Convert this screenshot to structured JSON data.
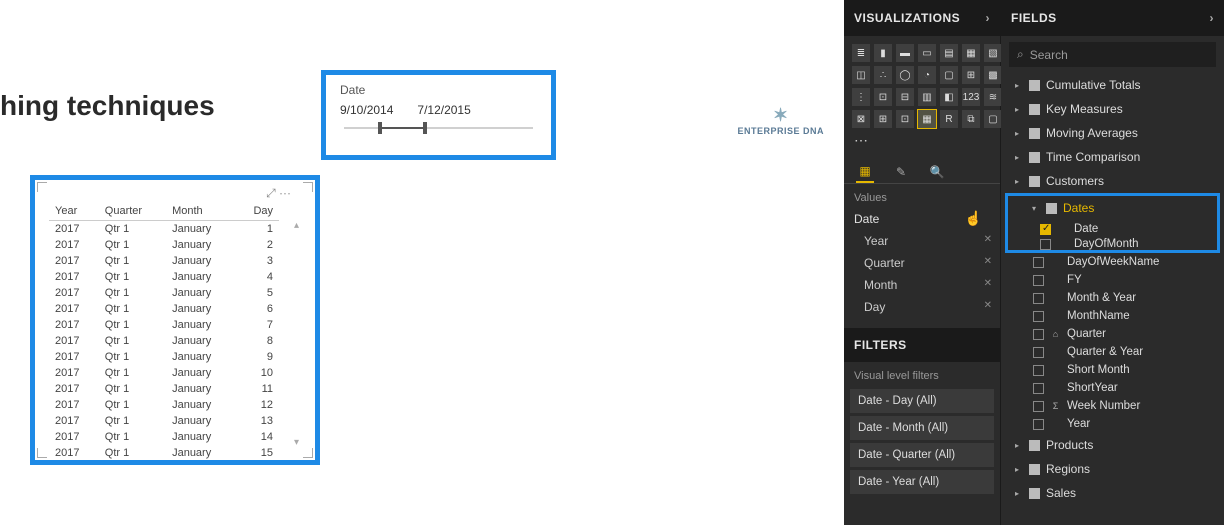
{
  "canvas": {
    "title": "hing techniques",
    "logo": "ENTERPRISE DNA"
  },
  "slicer": {
    "label": "Date",
    "start": "9/10/2014",
    "end": "7/12/2015"
  },
  "table": {
    "headers": [
      "Year",
      "Quarter",
      "Month",
      "Day"
    ],
    "rows": [
      [
        "2017",
        "Qtr 1",
        "January",
        "1"
      ],
      [
        "2017",
        "Qtr 1",
        "January",
        "2"
      ],
      [
        "2017",
        "Qtr 1",
        "January",
        "3"
      ],
      [
        "2017",
        "Qtr 1",
        "January",
        "4"
      ],
      [
        "2017",
        "Qtr 1",
        "January",
        "5"
      ],
      [
        "2017",
        "Qtr 1",
        "January",
        "6"
      ],
      [
        "2017",
        "Qtr 1",
        "January",
        "7"
      ],
      [
        "2017",
        "Qtr 1",
        "January",
        "8"
      ],
      [
        "2017",
        "Qtr 1",
        "January",
        "9"
      ],
      [
        "2017",
        "Qtr 1",
        "January",
        "10"
      ],
      [
        "2017",
        "Qtr 1",
        "January",
        "11"
      ],
      [
        "2017",
        "Qtr 1",
        "January",
        "12"
      ],
      [
        "2017",
        "Qtr 1",
        "January",
        "13"
      ],
      [
        "2017",
        "Qtr 1",
        "January",
        "14"
      ],
      [
        "2017",
        "Qtr 1",
        "January",
        "15"
      ]
    ]
  },
  "viz": {
    "header": "VISUALIZATIONS",
    "values_label": "Values",
    "values_parent": "Date",
    "values_items": [
      "Year",
      "Quarter",
      "Month",
      "Day"
    ],
    "filters_header": "FILTERS",
    "filters_sub": "Visual level filters",
    "filters": [
      "Date - Day (All)",
      "Date - Month (All)",
      "Date - Quarter (All)",
      "Date - Year (All)"
    ]
  },
  "fields": {
    "header": "FIELDS",
    "search_placeholder": "Search",
    "tables_top": [
      "Cumulative Totals",
      "Key Measures",
      "Moving Averages",
      "Time Comparison",
      "Customers"
    ],
    "highlight_table": "Dates",
    "highlight_checked": "Date",
    "highlight_cut": "DayOfMonth",
    "date_fields": [
      {
        "name": "DayOfWeekName",
        "ico": ""
      },
      {
        "name": "FY",
        "ico": ""
      },
      {
        "name": "Month & Year",
        "ico": ""
      },
      {
        "name": "MonthName",
        "ico": ""
      },
      {
        "name": "Quarter",
        "ico": "⌂"
      },
      {
        "name": "Quarter & Year",
        "ico": ""
      },
      {
        "name": "Short Month",
        "ico": ""
      },
      {
        "name": "ShortYear",
        "ico": ""
      },
      {
        "name": "Week Number",
        "ico": "Σ"
      },
      {
        "name": "Year",
        "ico": ""
      }
    ],
    "tables_bottom": [
      "Products",
      "Regions",
      "Sales"
    ]
  }
}
